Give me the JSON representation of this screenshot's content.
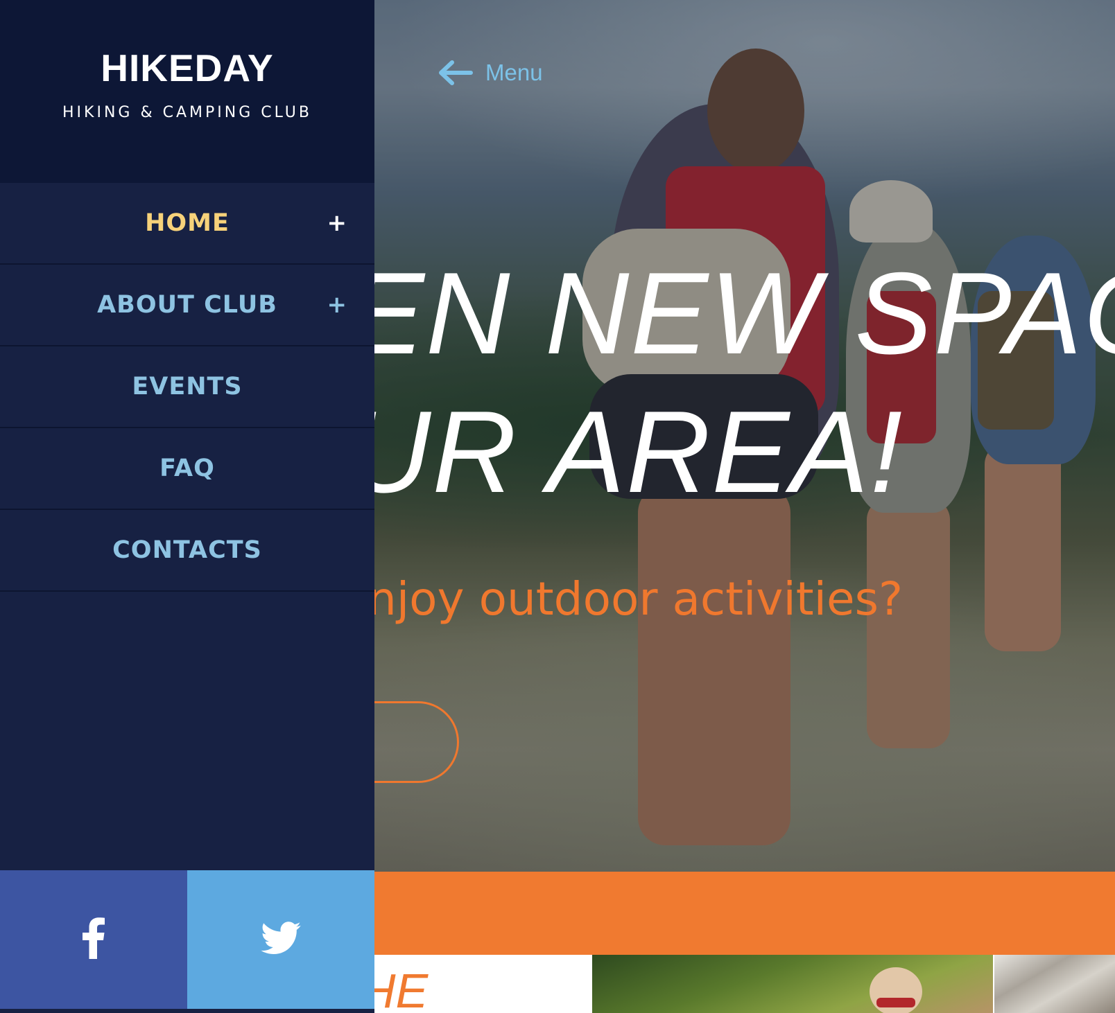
{
  "brand": {
    "name": "HIKEDAY",
    "tagline": "HIKING & CAMPING CLUB"
  },
  "nav": {
    "items": [
      {
        "label": "HOME",
        "active": true,
        "expand": "+"
      },
      {
        "label": "ABOUT CLUB",
        "active": false,
        "expand": "+"
      },
      {
        "label": "EVENTS",
        "active": false
      },
      {
        "label": "FAQ",
        "active": false
      },
      {
        "label": "CONTACTS",
        "active": false
      }
    ]
  },
  "social": {
    "facebook_icon": "facebook-icon",
    "twitter_icon": "twitter-icon"
  },
  "header": {
    "menu_label": "Menu",
    "menu_icon": "arrow-left-icon"
  },
  "hero": {
    "title_line_1": "EN NEW SPACE",
    "title_line_2": "UR AREA!",
    "subtitle": "njoy outdoor activities?",
    "button_label": "›"
  },
  "section": {
    "heading_fragment": "HE"
  },
  "colors": {
    "sidebar_bg": "#172143",
    "brand_bg": "#0d1736",
    "nav_text": "#8ec3e2",
    "nav_active": "#f7d27a",
    "accent_orange": "#f07a30",
    "facebook_blue": "#3d55a2",
    "twitter_blue": "#5da9e0",
    "menu_link": "#7cc2e8"
  }
}
